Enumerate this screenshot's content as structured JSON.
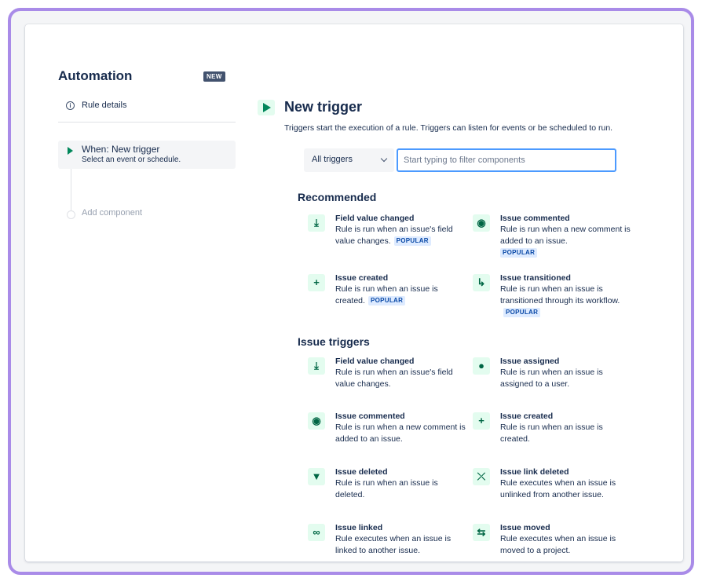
{
  "sidebar": {
    "title": "Automation",
    "badge": "NEW",
    "rule_details": "Rule details",
    "when_title": "When: New trigger",
    "when_subtitle": "Select an event or schedule.",
    "add_component": "Add component"
  },
  "main": {
    "title": "New trigger",
    "description": "Triggers start the execution of a rule. Triggers can listen for events or be scheduled to run.",
    "filter_select_value": "All triggers",
    "filter_placeholder": "Start typing to filter components",
    "popular_label": "POPULAR",
    "recommended": {
      "heading": "Recommended",
      "items": [
        {
          "name": "Field value changed",
          "desc": "Rule is run when an issue's field value changes.",
          "icon": "field-change-icon"
        },
        {
          "name": "Issue commented",
          "desc": "Rule is run when a new comment is added to an issue.",
          "icon": "comment-icon"
        },
        {
          "name": "Issue created",
          "desc": "Rule is run when an issue is created.",
          "icon": "plus-icon"
        },
        {
          "name": "Issue transitioned",
          "desc": "Rule is run when an issue is transitioned through its workflow.",
          "icon": "transition-icon"
        }
      ]
    },
    "issue_triggers": {
      "heading": "Issue triggers",
      "items": [
        {
          "name": "Field value changed",
          "desc": "Rule is run when an issue's field value changes.",
          "icon": "field-change-icon"
        },
        {
          "name": "Issue assigned",
          "desc": "Rule is run when an issue is assigned to a user.",
          "icon": "user-icon"
        },
        {
          "name": "Issue commented",
          "desc": "Rule is run when a new comment is added to an issue.",
          "icon": "comment-icon"
        },
        {
          "name": "Issue created",
          "desc": "Rule is run when an issue is created.",
          "icon": "plus-icon"
        },
        {
          "name": "Issue deleted",
          "desc": "Rule is run when an issue is deleted.",
          "icon": "trash-icon"
        },
        {
          "name": "Issue link deleted",
          "desc": "Rule executes when an issue is unlinked from another issue.",
          "icon": "unlink-icon"
        },
        {
          "name": "Issue linked",
          "desc": "Rule executes when an issue is linked to another issue.",
          "icon": "link-icon"
        },
        {
          "name": "Issue moved",
          "desc": "Rule executes when an issue is moved to a project.",
          "icon": "move-icon"
        }
      ]
    }
  }
}
